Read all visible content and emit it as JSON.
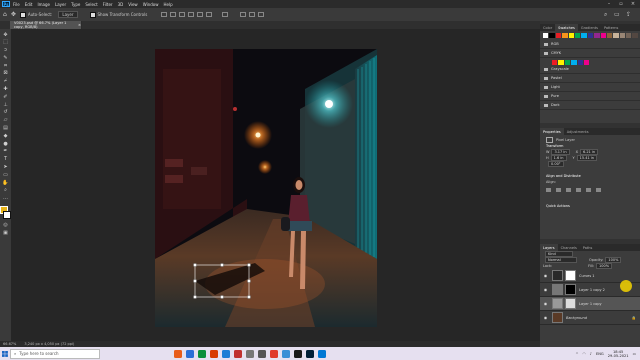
{
  "menubar": {
    "logo": "Ps",
    "items": [
      "File",
      "Edit",
      "Image",
      "Layer",
      "Type",
      "Select",
      "Filter",
      "3D",
      "View",
      "Window",
      "Help"
    ]
  },
  "options": {
    "auto_select_label": "Auto-Select:",
    "auto_select_value": "Layer",
    "show_transform_label": "Show Transform Controls"
  },
  "document": {
    "tab_title": "V0023.psd @ 66.7% (Layer 1 copy, RGB/8)",
    "status_zoom": "66.67%",
    "status_size": "3,240 px x 4,050 px (72 ppi)"
  },
  "panels": {
    "swatches_tabs": [
      "Color",
      "Swatches",
      "Gradients",
      "Patterns"
    ],
    "swatch_colors": [
      "#ffffff",
      "#000000",
      "#e31e24",
      "#f7941d",
      "#fff200",
      "#00a651",
      "#00aeef",
      "#2e3192",
      "#92278f",
      "#ec008c",
      "#8c6239",
      "#c7b299",
      "#998675",
      "#736357",
      "#534741"
    ],
    "swatch_colors_row2": [
      "#ed1c24",
      "#fff200",
      "#00a651",
      "#00aeef",
      "#2e3192",
      "#ec008c"
    ],
    "folders": [
      "RGB",
      "CMYK",
      "Grayscale",
      "Pastel",
      "Light",
      "Pure",
      "Dark"
    ],
    "properties_tabs": [
      "Properties",
      "Adjustments"
    ],
    "pixel_layer_label": "Pixel Layer",
    "transform_label": "Transform",
    "w_label": "W",
    "w_value": "3.17 in",
    "h_label": "H",
    "h_value": "1.6 in",
    "x_label": "X",
    "x_value": "6.21 in",
    "y_label": "Y",
    "y_value": "15.41 in",
    "angle_value": "0.00°",
    "align_label": "Align and Distribute",
    "align_sub": "Align:",
    "quick_actions_label": "Quick Actions",
    "layers_tabs": [
      "Layers",
      "Channels",
      "Paths"
    ],
    "kind_label": "Kind",
    "blend_mode": "Normal",
    "opacity_label": "Opacity:",
    "opacity_value": "100%",
    "lock_label": "Lock:",
    "fill_label": "Fill:",
    "fill_value": "100%",
    "layers": [
      {
        "name": "Curves 1"
      },
      {
        "name": "Layer 1 copy 2"
      },
      {
        "name": "Layer 1 copy"
      },
      {
        "name": "Background"
      }
    ]
  },
  "taskbar": {
    "search_placeholder": "Type here to search",
    "app_colors": [
      "#e85c1a",
      "#2b6fd6",
      "#0b8f3a",
      "#d83b01",
      "#1c7ed6",
      "#c03030",
      "#777777",
      "#555555",
      "#e0392b",
      "#3a8fd6",
      "#1a1a1a",
      "#001e36",
      "#0078d4"
    ],
    "time": "18:45",
    "date": "29-05-2021",
    "lang": "ENG"
  }
}
